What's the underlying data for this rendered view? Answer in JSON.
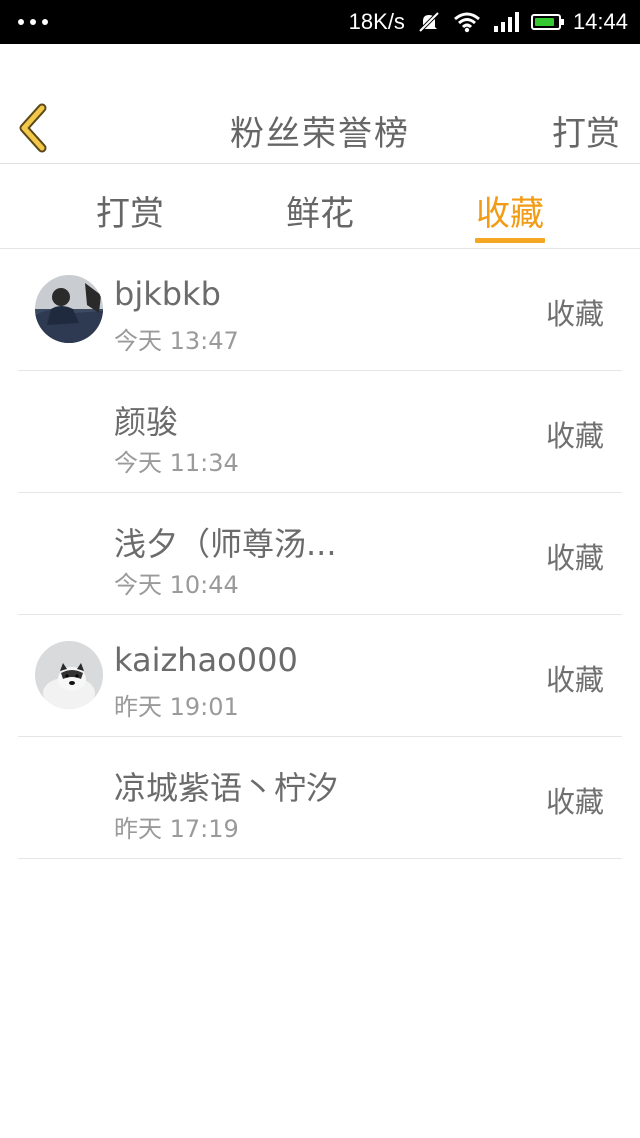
{
  "status_bar": {
    "speed": "18K/s",
    "time": "14:44",
    "battery_level": 0.85
  },
  "header": {
    "title": "粉丝荣誉榜",
    "right_label": "打赏"
  },
  "tabs": [
    {
      "label": "打赏",
      "active": false
    },
    {
      "label": "鲜花",
      "active": false
    },
    {
      "label": "收藏",
      "active": true
    }
  ],
  "colors": {
    "accent": "#f5a623",
    "text": "#666666",
    "subtext": "#9a9a9a"
  },
  "fans": [
    {
      "name": "bjkbkb",
      "time": "今天 13:47",
      "action": "收藏",
      "avatar": "photo-person"
    },
    {
      "name": "颜骏",
      "time": "今天 11:34",
      "action": "收藏",
      "avatar": ""
    },
    {
      "name": "浅夕（师尊汤...",
      "time": "今天 10:44",
      "action": "收藏",
      "avatar": ""
    },
    {
      "name": "kaizhao000",
      "time": "昨天 19:01",
      "action": "收藏",
      "avatar": "photo-dog"
    },
    {
      "name": "凉城紫语丶柠汐",
      "time": "昨天 17:19",
      "action": "收藏",
      "avatar": ""
    }
  ]
}
